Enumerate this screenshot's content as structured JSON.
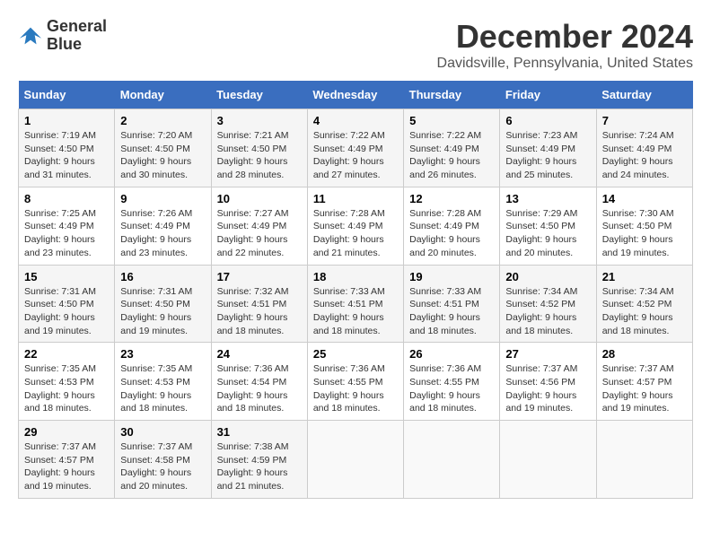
{
  "header": {
    "logo_line1": "General",
    "logo_line2": "Blue",
    "title": "December 2024",
    "subtitle": "Davidsville, Pennsylvania, United States"
  },
  "days_of_week": [
    "Sunday",
    "Monday",
    "Tuesday",
    "Wednesday",
    "Thursday",
    "Friday",
    "Saturday"
  ],
  "weeks": [
    [
      {
        "day": "1",
        "sunrise": "7:19 AM",
        "sunset": "4:50 PM",
        "daylight": "9 hours and 31 minutes."
      },
      {
        "day": "2",
        "sunrise": "7:20 AM",
        "sunset": "4:50 PM",
        "daylight": "9 hours and 30 minutes."
      },
      {
        "day": "3",
        "sunrise": "7:21 AM",
        "sunset": "4:50 PM",
        "daylight": "9 hours and 28 minutes."
      },
      {
        "day": "4",
        "sunrise": "7:22 AM",
        "sunset": "4:49 PM",
        "daylight": "9 hours and 27 minutes."
      },
      {
        "day": "5",
        "sunrise": "7:22 AM",
        "sunset": "4:49 PM",
        "daylight": "9 hours and 26 minutes."
      },
      {
        "day": "6",
        "sunrise": "7:23 AM",
        "sunset": "4:49 PM",
        "daylight": "9 hours and 25 minutes."
      },
      {
        "day": "7",
        "sunrise": "7:24 AM",
        "sunset": "4:49 PM",
        "daylight": "9 hours and 24 minutes."
      }
    ],
    [
      {
        "day": "8",
        "sunrise": "7:25 AM",
        "sunset": "4:49 PM",
        "daylight": "9 hours and 23 minutes."
      },
      {
        "day": "9",
        "sunrise": "7:26 AM",
        "sunset": "4:49 PM",
        "daylight": "9 hours and 23 minutes."
      },
      {
        "day": "10",
        "sunrise": "7:27 AM",
        "sunset": "4:49 PM",
        "daylight": "9 hours and 22 minutes."
      },
      {
        "day": "11",
        "sunrise": "7:28 AM",
        "sunset": "4:49 PM",
        "daylight": "9 hours and 21 minutes."
      },
      {
        "day": "12",
        "sunrise": "7:28 AM",
        "sunset": "4:49 PM",
        "daylight": "9 hours and 20 minutes."
      },
      {
        "day": "13",
        "sunrise": "7:29 AM",
        "sunset": "4:50 PM",
        "daylight": "9 hours and 20 minutes."
      },
      {
        "day": "14",
        "sunrise": "7:30 AM",
        "sunset": "4:50 PM",
        "daylight": "9 hours and 19 minutes."
      }
    ],
    [
      {
        "day": "15",
        "sunrise": "7:31 AM",
        "sunset": "4:50 PM",
        "daylight": "9 hours and 19 minutes."
      },
      {
        "day": "16",
        "sunrise": "7:31 AM",
        "sunset": "4:50 PM",
        "daylight": "9 hours and 19 minutes."
      },
      {
        "day": "17",
        "sunrise": "7:32 AM",
        "sunset": "4:51 PM",
        "daylight": "9 hours and 18 minutes."
      },
      {
        "day": "18",
        "sunrise": "7:33 AM",
        "sunset": "4:51 PM",
        "daylight": "9 hours and 18 minutes."
      },
      {
        "day": "19",
        "sunrise": "7:33 AM",
        "sunset": "4:51 PM",
        "daylight": "9 hours and 18 minutes."
      },
      {
        "day": "20",
        "sunrise": "7:34 AM",
        "sunset": "4:52 PM",
        "daylight": "9 hours and 18 minutes."
      },
      {
        "day": "21",
        "sunrise": "7:34 AM",
        "sunset": "4:52 PM",
        "daylight": "9 hours and 18 minutes."
      }
    ],
    [
      {
        "day": "22",
        "sunrise": "7:35 AM",
        "sunset": "4:53 PM",
        "daylight": "9 hours and 18 minutes."
      },
      {
        "day": "23",
        "sunrise": "7:35 AM",
        "sunset": "4:53 PM",
        "daylight": "9 hours and 18 minutes."
      },
      {
        "day": "24",
        "sunrise": "7:36 AM",
        "sunset": "4:54 PM",
        "daylight": "9 hours and 18 minutes."
      },
      {
        "day": "25",
        "sunrise": "7:36 AM",
        "sunset": "4:55 PM",
        "daylight": "9 hours and 18 minutes."
      },
      {
        "day": "26",
        "sunrise": "7:36 AM",
        "sunset": "4:55 PM",
        "daylight": "9 hours and 18 minutes."
      },
      {
        "day": "27",
        "sunrise": "7:37 AM",
        "sunset": "4:56 PM",
        "daylight": "9 hours and 19 minutes."
      },
      {
        "day": "28",
        "sunrise": "7:37 AM",
        "sunset": "4:57 PM",
        "daylight": "9 hours and 19 minutes."
      }
    ],
    [
      {
        "day": "29",
        "sunrise": "7:37 AM",
        "sunset": "4:57 PM",
        "daylight": "9 hours and 19 minutes."
      },
      {
        "day": "30",
        "sunrise": "7:37 AM",
        "sunset": "4:58 PM",
        "daylight": "9 hours and 20 minutes."
      },
      {
        "day": "31",
        "sunrise": "7:38 AM",
        "sunset": "4:59 PM",
        "daylight": "9 hours and 21 minutes."
      },
      null,
      null,
      null,
      null
    ]
  ],
  "labels": {
    "sunrise": "Sunrise:",
    "sunset": "Sunset:",
    "daylight": "Daylight:"
  }
}
